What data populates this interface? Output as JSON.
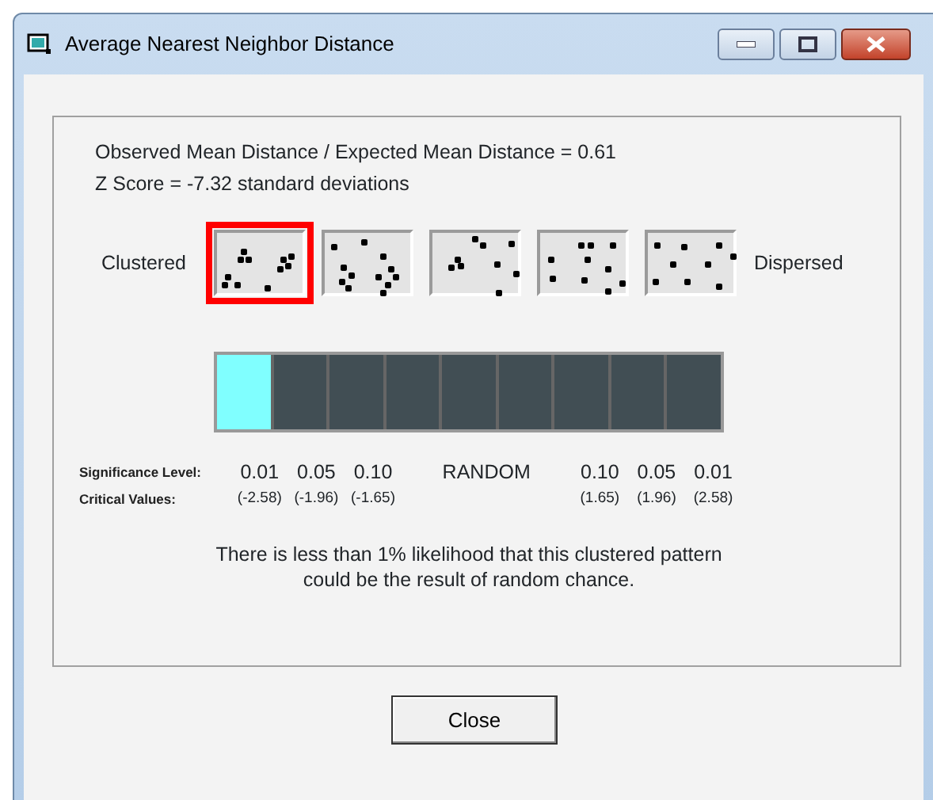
{
  "window": {
    "title": "Average Nearest Neighbor Distance"
  },
  "ratio_text": "Observed Mean Distance / Expected Mean Distance = 0.61",
  "z_score_text": "Z Score = -7.32 standard deviations",
  "left_label": "Clustered",
  "right_label": "Dispersed",
  "patterns": [
    {
      "selected": true
    },
    {
      "selected": false
    },
    {
      "selected": false
    },
    {
      "selected": false
    },
    {
      "selected": false
    }
  ],
  "scale_cells": [
    {
      "selected": true
    },
    {
      "selected": false
    },
    {
      "selected": false
    },
    {
      "selected": false
    },
    {
      "selected": false
    },
    {
      "selected": false
    },
    {
      "selected": false
    },
    {
      "selected": false
    },
    {
      "selected": false
    }
  ],
  "significance_label": "Significance Level:",
  "critical_label": "Critical Values:",
  "significance_levels": [
    "0.01",
    "0.05",
    "0.10",
    "RANDOM",
    "0.10",
    "0.05",
    "0.01"
  ],
  "critical_values": [
    "(-2.58)",
    "(-1.96)",
    "(-1.65)",
    "(1.65)",
    "(1.96)",
    "(2.58)"
  ],
  "conclusion": "There is less than 1% likelihood that this clustered pattern could be the result of random chance.",
  "buttons": [
    "Close"
  ]
}
